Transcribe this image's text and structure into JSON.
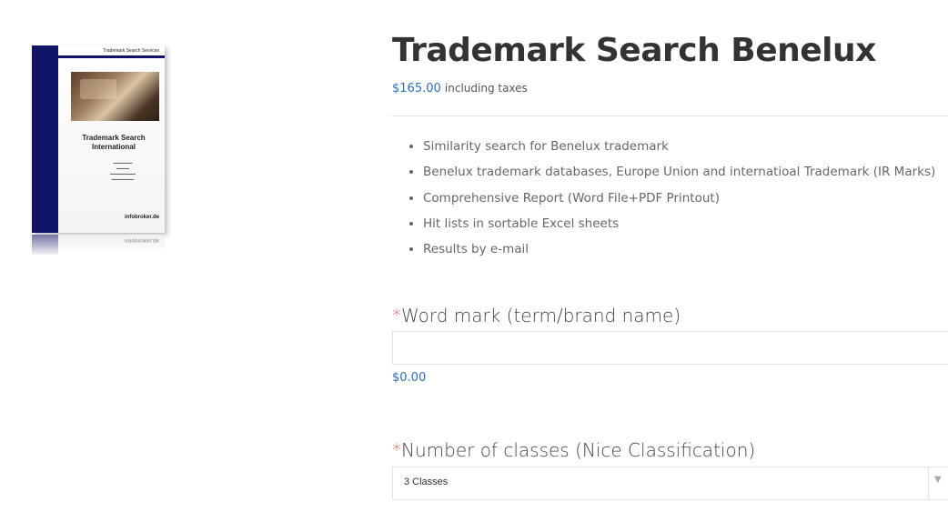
{
  "product": {
    "image": {
      "series_label": "Trademark Search Services",
      "cover_title_line1": "Trademark Search",
      "cover_title_line2": "International",
      "brand": "infobroker.de",
      "photo_icon": "office-photo"
    },
    "title": "Trademark Search Benelux",
    "price": "$165.00",
    "price_suffix": "including taxes",
    "features": [
      "Similarity search for Benelux trademark",
      "Benelux trademark databases, Europe Union and internatioal Trademark (IR Marks)",
      "Comprehensive Report (Word File+PDF Printout)",
      "Hit lists in sortable Excel sheets",
      "Results by e-mail"
    ]
  },
  "form": {
    "required_marker": "*",
    "word_mark": {
      "label": "Word mark (term/brand name)",
      "value": "",
      "price": "$0.00"
    },
    "classes": {
      "label": "Number of classes (Nice Classification)",
      "selected": "3 Classes",
      "arrow_icon": "chevron-down-icon"
    }
  },
  "colors": {
    "accent_blue": "#2a6ebb",
    "brochure_navy": "#0f1466",
    "required_red": "#d9534f"
  }
}
